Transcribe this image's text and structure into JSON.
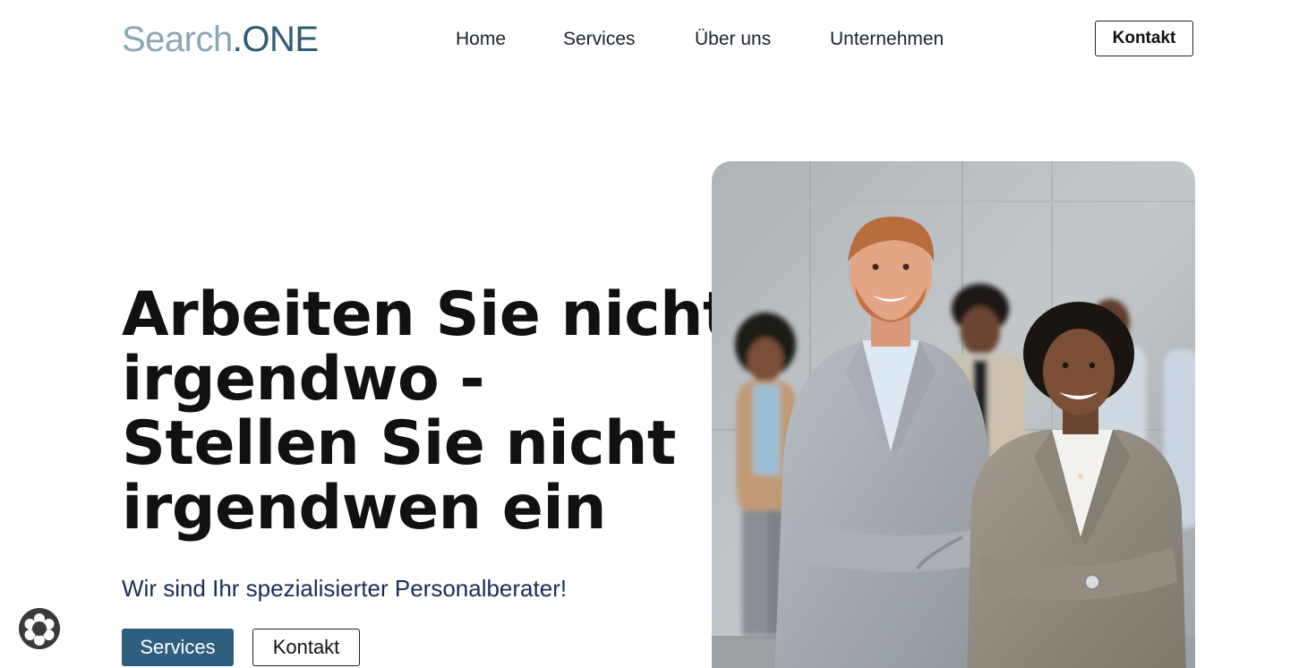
{
  "logo": {
    "light": "Search",
    "dot": ".",
    "strong": "ONE"
  },
  "nav": {
    "items": [
      "Home",
      "Services",
      "Über uns",
      "Unternehmen"
    ],
    "contact_label": "Kontakt"
  },
  "hero": {
    "title_lines": [
      "Arbeiten Sie nicht",
      "irgendwo -",
      "Stellen Sie nicht",
      "irgendwen ein"
    ],
    "subtitle": "Wir sind Ihr spezialisierter Personalberater!",
    "primary_button": "Services",
    "secondary_button": "Kontakt"
  },
  "colors": {
    "brand": "#2f5f7e",
    "subtitle": "#1c2c5a",
    "logo_light": "#8aa7b5"
  },
  "icons": {
    "cookie": "cookie-settings-icon"
  }
}
